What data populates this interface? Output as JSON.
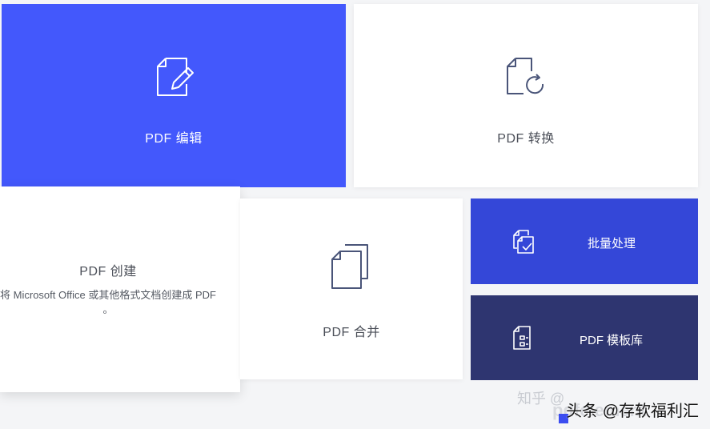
{
  "tiles": {
    "edit": {
      "label": "PDF 编辑",
      "icon": "document-edit-icon"
    },
    "convert": {
      "label": "PDF 转换",
      "icon": "document-convert-icon"
    },
    "create": {
      "title": "PDF 创建",
      "description": "将 Microsoft Office 或其他格式文档创建成 PDF",
      "description_tail": "。",
      "icon": "none"
    },
    "merge": {
      "label": "PDF 合并",
      "icon": "documents-stack-icon"
    },
    "batch": {
      "label": "批量处理",
      "icon": "batch-process-icon"
    },
    "template": {
      "label": "PDF 模板库",
      "icon": "template-icon"
    }
  },
  "watermark": {
    "zhihu": "知乎 @",
    "text": "头条 @存软福利汇",
    "logo_text": "pdfelement"
  },
  "colors": {
    "primary_blue": "#4358fc",
    "batch_blue": "#3447d8",
    "template_navy": "#2e3570",
    "tile_white": "#ffffff",
    "page_bg": "#f4f5f7"
  }
}
